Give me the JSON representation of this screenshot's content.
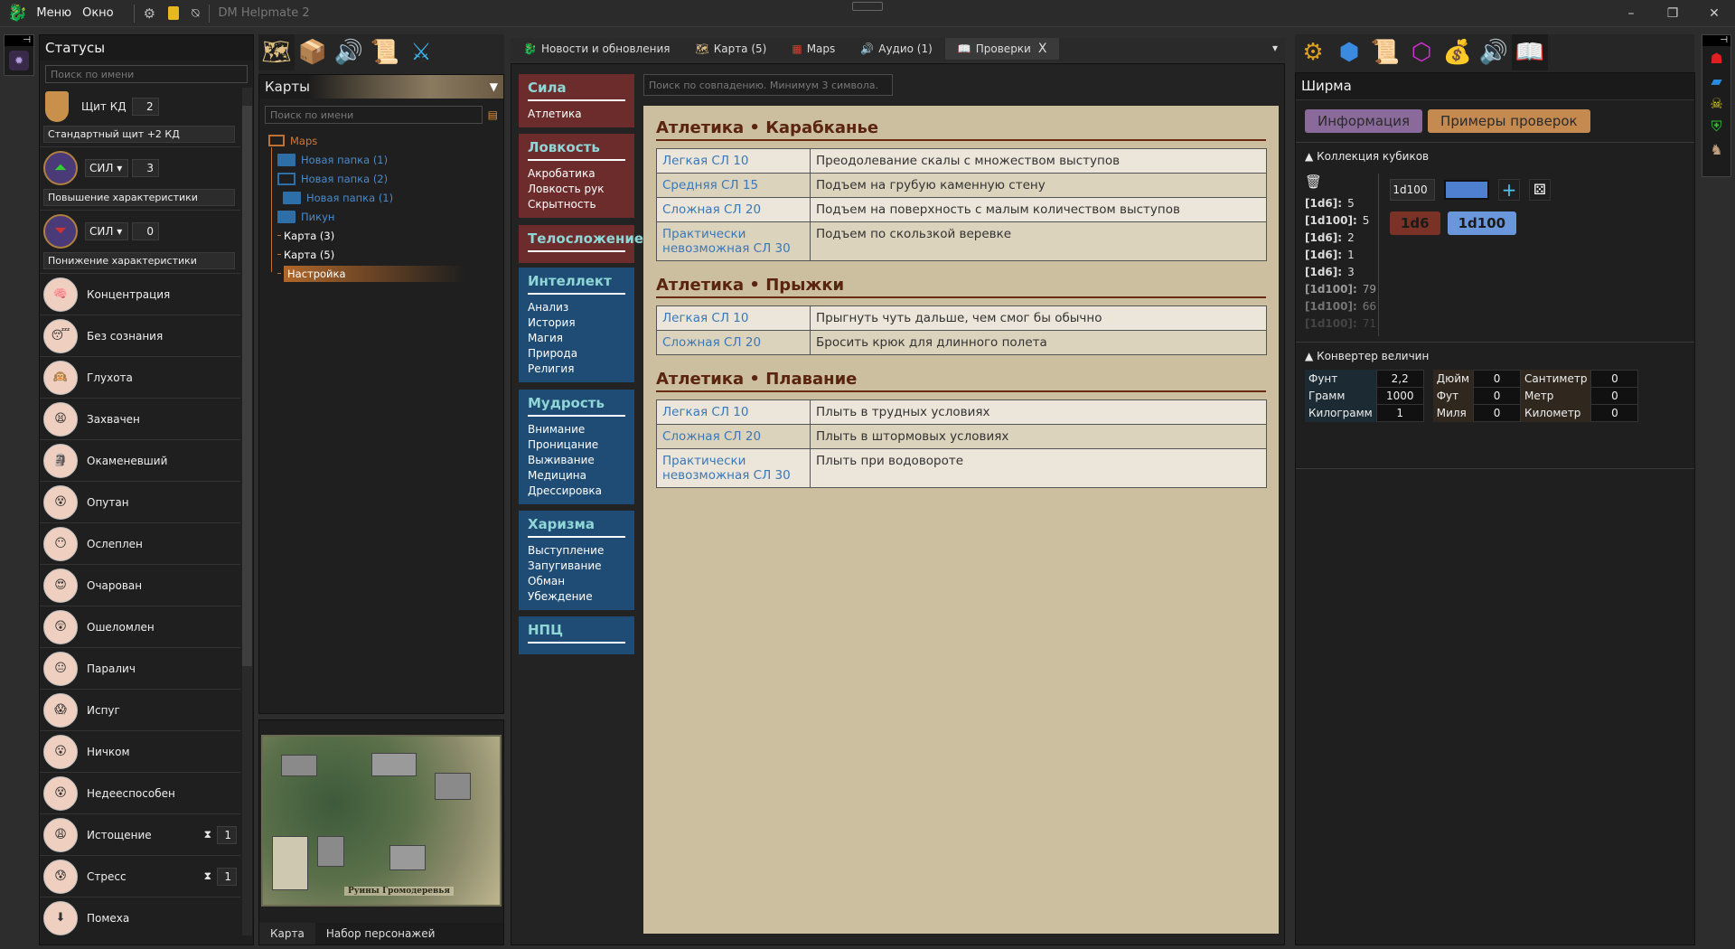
{
  "titlebar": {
    "menu": "Меню",
    "window": "Окно",
    "app_title": "DM Helpmate 2",
    "minimize": "–",
    "maximize": "❐",
    "close": "✕"
  },
  "statuses": {
    "title": "Статусы",
    "search_placeholder": "Поиск по имени",
    "shield": {
      "label": "Щит КД",
      "value": "2",
      "description": "Стандартный щит +2 КД"
    },
    "buff": {
      "stat": "СИЛ",
      "value": "3",
      "description": "Повышение характеристики"
    },
    "debuff": {
      "stat": "СИЛ",
      "value": "0",
      "description": "Понижение характеристики"
    },
    "items": [
      {
        "label": "Концентрация",
        "face": "🧠"
      },
      {
        "label": "Без сознания",
        "face": "😴"
      },
      {
        "label": "Глухота",
        "face": "🙉"
      },
      {
        "label": "Захвачен",
        "face": "😫"
      },
      {
        "label": "Окаменевший",
        "face": "🗿"
      },
      {
        "label": "Опутан",
        "face": "😵"
      },
      {
        "label": "Ослеплен",
        "face": "😶"
      },
      {
        "label": "Очарован",
        "face": "😍"
      },
      {
        "label": "Ошеломлен",
        "face": "😲"
      },
      {
        "label": "Паралич",
        "face": "😐"
      },
      {
        "label": "Испуг",
        "face": "😱"
      },
      {
        "label": "Ничком",
        "face": "😮"
      },
      {
        "label": "Недееспособен",
        "face": "😵"
      },
      {
        "label": "Истощение",
        "face": "😩",
        "counter": "1"
      },
      {
        "label": "Стресс",
        "face": "😰",
        "counter": "1"
      },
      {
        "label": "Помеха",
        "face": "⬇"
      }
    ]
  },
  "maps": {
    "title": "Карты",
    "search_placeholder": "Поиск по имени",
    "tree": [
      {
        "label": "Maps",
        "level": 0,
        "kind": "root"
      },
      {
        "label": "Новая папка (1)",
        "level": 1,
        "kind": "folder"
      },
      {
        "label": "Новая папка (2)",
        "level": 1,
        "kind": "folder-open"
      },
      {
        "label": "Новая папка (1)",
        "level": 2,
        "kind": "folder"
      },
      {
        "label": "Пикун",
        "level": 1,
        "kind": "folder"
      },
      {
        "label": "Карта (3)",
        "level": 1,
        "kind": "file"
      },
      {
        "label": "Карта (5)",
        "level": 1,
        "kind": "file"
      },
      {
        "label": "Настройка",
        "level": 1,
        "kind": "selected"
      }
    ],
    "preview_caption": "Руины Громодеревья",
    "bottom_tabs": [
      "Карта",
      "Набор персонажей"
    ]
  },
  "center": {
    "tabs": [
      {
        "label": "Новости и обновления",
        "icon": "dragon"
      },
      {
        "label": "Карта (5)",
        "icon": "map"
      },
      {
        "label": "Maps",
        "icon": "maps"
      },
      {
        "label": "Аудио (1)",
        "icon": "speaker"
      },
      {
        "label": "Проверки",
        "icon": "book",
        "active": true
      }
    ],
    "close": "X",
    "search_placeholder": "Поиск по совпадению. Минимум 3 символа.",
    "categories": [
      {
        "title": "Сила",
        "items": [
          "Атлетика"
        ],
        "color": "#6d2c2c"
      },
      {
        "title": "Ловкость",
        "items": [
          "Акробатика",
          "Ловкость рук",
          "Скрытность"
        ],
        "color": "#6d2c2c"
      },
      {
        "title": "Телосложение",
        "items": [],
        "color": "#6d2c2c"
      },
      {
        "title": "Интеллект",
        "items": [
          "Анализ",
          "История",
          "Магия",
          "Природа",
          "Религия"
        ],
        "color": "#1f4c74"
      },
      {
        "title": "Мудрость",
        "items": [
          "Внимание",
          "Проницание",
          "Выживание",
          "Медицина",
          "Дрессировка"
        ],
        "color": "#1f4c74"
      },
      {
        "title": "Харизма",
        "items": [
          "Выступление",
          "Запугивание",
          "Обман",
          "Убеждение"
        ],
        "color": "#1f4c74"
      },
      {
        "title": "НПЦ",
        "items": [],
        "color": "#1f4c74"
      }
    ],
    "sections": [
      {
        "title": "Атлетика • Карабканье",
        "rows": [
          [
            "Легкая СЛ 10",
            "Преодолевание скалы с множеством выступов"
          ],
          [
            "Средняя СЛ 15",
            "Подъем на грубую каменную стену"
          ],
          [
            "Сложная СЛ 20",
            "Подъем на поверхность с малым количеством выступов"
          ],
          [
            "Практически невозможная СЛ 30",
            "Подъем по скользкой веревке"
          ]
        ]
      },
      {
        "title": "Атлетика • Прыжки",
        "rows": [
          [
            "Легкая СЛ 10",
            "Прыгнуть чуть дальше, чем смог бы обычно"
          ],
          [
            "Сложная СЛ 20",
            "Бросить крюк для длинного полета"
          ]
        ]
      },
      {
        "title": "Атлетика • Плавание",
        "rows": [
          [
            "Легкая СЛ 10",
            "Плыть в трудных условиях"
          ],
          [
            "Сложная СЛ 20",
            "Плыть в штормовых условиях"
          ],
          [
            "Практически невозможная СЛ 30",
            "Плыть при водовороте"
          ]
        ]
      }
    ]
  },
  "screen": {
    "title": "Ширма",
    "info_button": "Информация",
    "examples_button": "Примеры проверок",
    "dice": {
      "title": "Коллекция кубиков",
      "input": "1d100",
      "color": "#4f7fcf",
      "log": [
        [
          "[1d6]:",
          "5"
        ],
        [
          "[1d100]:",
          "5"
        ],
        [
          "[1d6]:",
          "2"
        ],
        [
          "[1d6]:",
          "1"
        ],
        [
          "[1d6]:",
          "3"
        ],
        [
          "[1d100]:",
          "79"
        ],
        [
          "[1d100]:",
          "66"
        ],
        [
          "[1d100]:",
          "71"
        ]
      ],
      "chips": [
        {
          "label": "1d6",
          "color": "#7a3226"
        },
        {
          "label": "1d100",
          "color": "#6a96dc"
        }
      ]
    },
    "converter": {
      "title": "Конвертер величин",
      "weight": [
        [
          "Фунт",
          "2,2"
        ],
        [
          "Грамм",
          "1000"
        ],
        [
          "Килограмм",
          "1"
        ]
      ],
      "length": [
        [
          "Дюйм",
          "0",
          "Сантиметр",
          "0"
        ],
        [
          "Фут",
          "0",
          "Метр",
          "0"
        ],
        [
          "Миля",
          "0",
          "Километр",
          "0"
        ]
      ]
    }
  }
}
